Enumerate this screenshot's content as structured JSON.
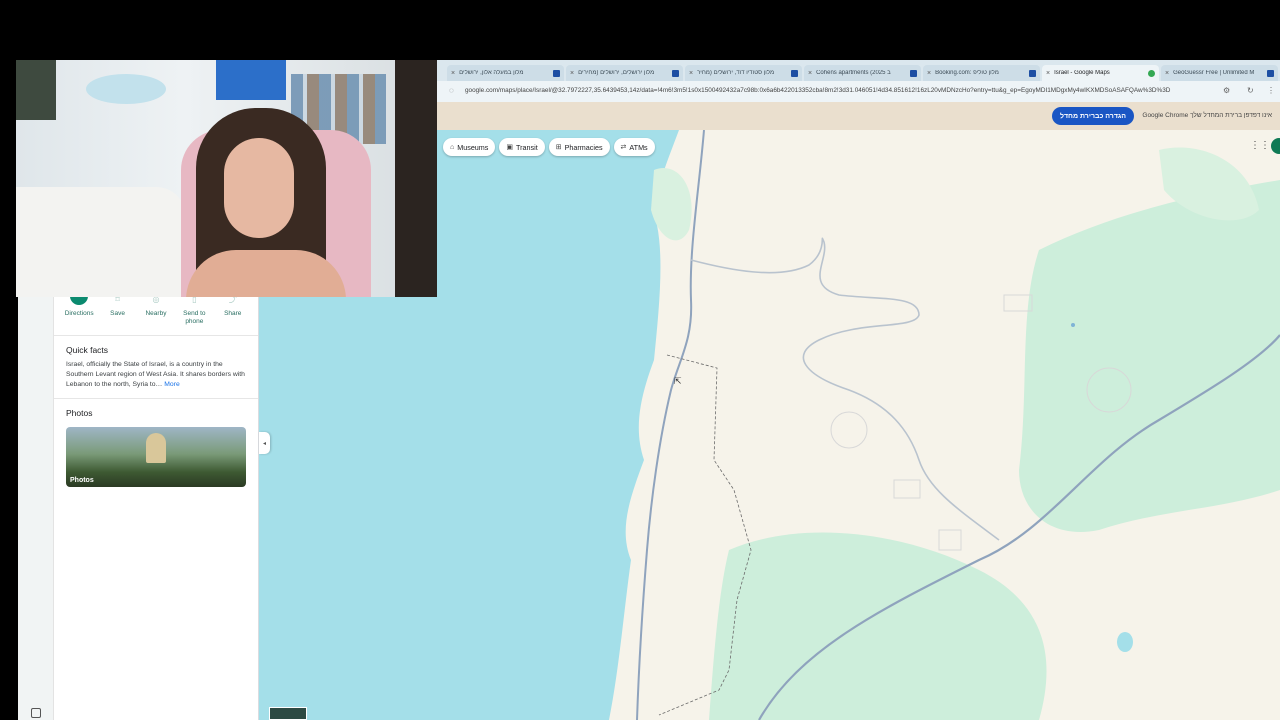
{
  "browser": {
    "tabs": [
      {
        "title": "מלון במעלה אלון, ירושלים",
        "active": false
      },
      {
        "title": "מלון ירושלים, ירושלים (מחירים",
        "active": false
      },
      {
        "title": "מלון סטודיו דוד, ירושלים (מחיר",
        "active": false
      },
      {
        "title": "Cohens apartments (2025 ב",
        "active": false
      },
      {
        "title": "Booking.com: מלון טוליפ",
        "active": false
      },
      {
        "title": "Israel - Google Maps",
        "active": true
      },
      {
        "title": "GeoGuessr Free | Unlimited M",
        "active": false
      }
    ],
    "url": "google.com/maps/place/Israel/@32.7972227,35.6439453,14z/data=!4m6!3m5!1s0x1500492432a7c98b:0x6a6b422013352cba!8m2!3d31.046051!4d34.851612!16zL20vMDNzcHo?entry=ttu&g_ep=EgoyMDI1MDgxMy4wIKXMDSoASAFQAw%3D%3D",
    "infobar": {
      "button": "הגדרה כברירת מחדל",
      "message": "Google Chrome אינו דפדפן ברירת המחדל שלך"
    }
  },
  "map_chips": [
    {
      "icon": "museum-icon",
      "label": "Museums"
    },
    {
      "icon": "transit-icon",
      "label": "Transit"
    },
    {
      "icon": "pharmacy-icon",
      "label": "Pharmacies"
    },
    {
      "icon": "atm-icon",
      "label": "ATMs"
    }
  ],
  "side_panel": {
    "actions": [
      {
        "label": "Directions"
      },
      {
        "label": "Save"
      },
      {
        "label": "Nearby"
      },
      {
        "label": "Send to phone"
      },
      {
        "label": "Share"
      }
    ],
    "quick_facts": {
      "title": "Quick facts",
      "text": "Israel, officially the State of Israel, is a country in the Southern Levant region of West Asia. It shares borders with Lebanon to the north, Syria to…",
      "more": "More"
    },
    "photos": {
      "title": "Photos",
      "card_label": "Photos"
    }
  },
  "colors": {
    "water": "#a4dfe9",
    "land": "#f6f3ea",
    "park": "#cdeedb",
    "road": "#8fa3bd",
    "accent": "#1a56c4",
    "teal": "#0b8a6f"
  }
}
